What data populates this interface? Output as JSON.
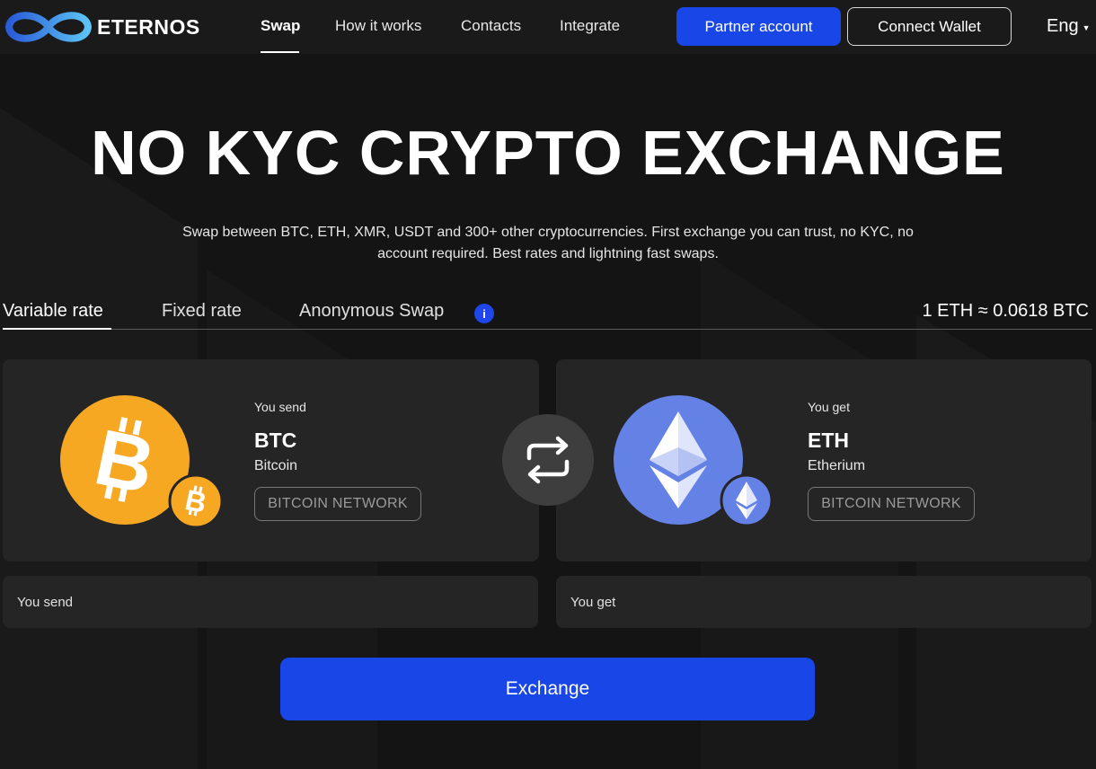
{
  "brand": {
    "name": "ETERNOS"
  },
  "nav": {
    "items": [
      {
        "label": "Swap",
        "active": true
      },
      {
        "label": "How it works"
      },
      {
        "label": "Contacts"
      },
      {
        "label": "Integrate"
      }
    ],
    "partner_label": "Partner account",
    "wallet_label": "Connect Wallet",
    "language": "Eng"
  },
  "hero": {
    "title": "NO KYC CRYPTO EXCHANGE",
    "subtitle": "Swap between BTC, ETH, XMR, USDT and 300+ other cryptocurrencies. First exchange you can trust, no KYC, no account required. Best rates and lightning fast swaps."
  },
  "tabs": {
    "items": [
      {
        "label": "Variable rate",
        "active": true
      },
      {
        "label": "Fixed rate"
      },
      {
        "label": "Anonymous Swap"
      }
    ],
    "info_icon": "i",
    "rate": "1 ETH ≈ 0.0618 BTC"
  },
  "send": {
    "label": "You send",
    "ticker": "BTC",
    "name": "Bitcoin",
    "network": "BITCOIN NETWORK",
    "amount_placeholder": "You send",
    "icon": "bitcoin-icon"
  },
  "get": {
    "label": "You get",
    "ticker": "ETH",
    "name": "Etherium",
    "network": "BITCOIN NETWORK",
    "amount_placeholder": "You get",
    "icon": "ethereum-icon"
  },
  "exchange_label": "Exchange",
  "colors": {
    "accent": "#1946e6",
    "background": "#141414",
    "card": "#252525",
    "bitcoin": "#f7a823",
    "ethereum": "#6481e6"
  }
}
